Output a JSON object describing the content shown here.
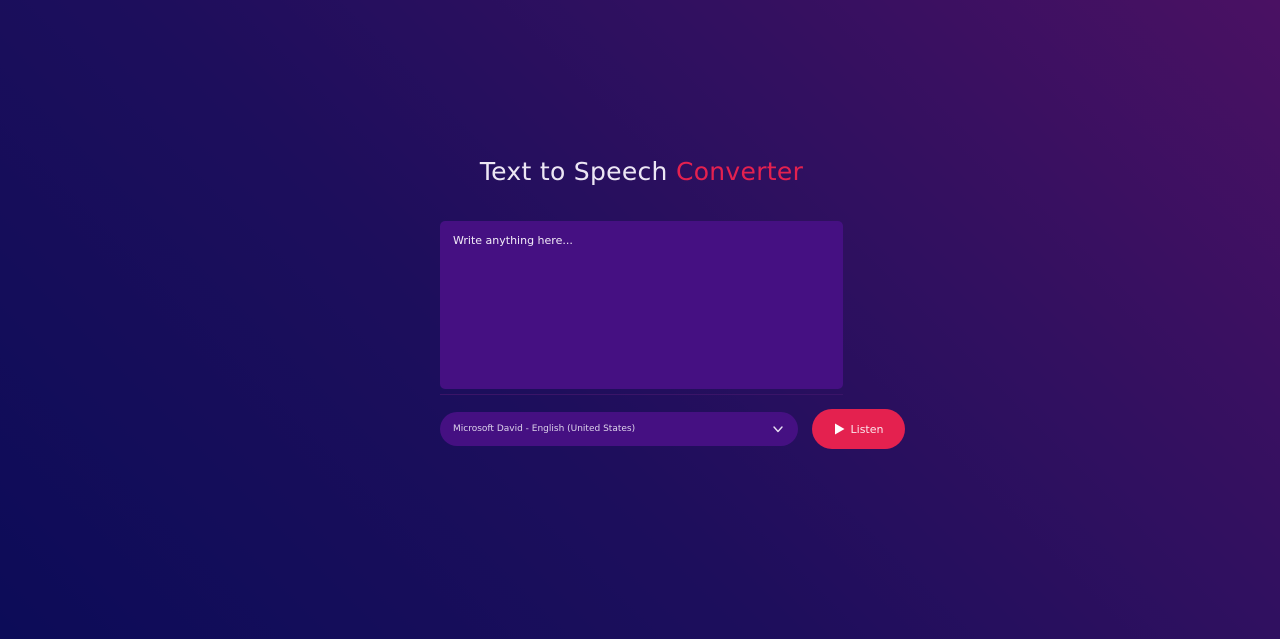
{
  "header": {
    "title_main": "Text to Speech",
    "title_accent": "Converter"
  },
  "editor": {
    "placeholder": "Write anything here...",
    "value": ""
  },
  "voice": {
    "selected": "Microsoft David - English (United States)",
    "icon": "chevron-down-icon"
  },
  "listen_button": {
    "label": "Listen",
    "icon": "play-icon"
  },
  "colors": {
    "accent": "#e4214f",
    "panel": "#451082",
    "background_start": "#0c0c58",
    "background_end": "#4a1163"
  }
}
